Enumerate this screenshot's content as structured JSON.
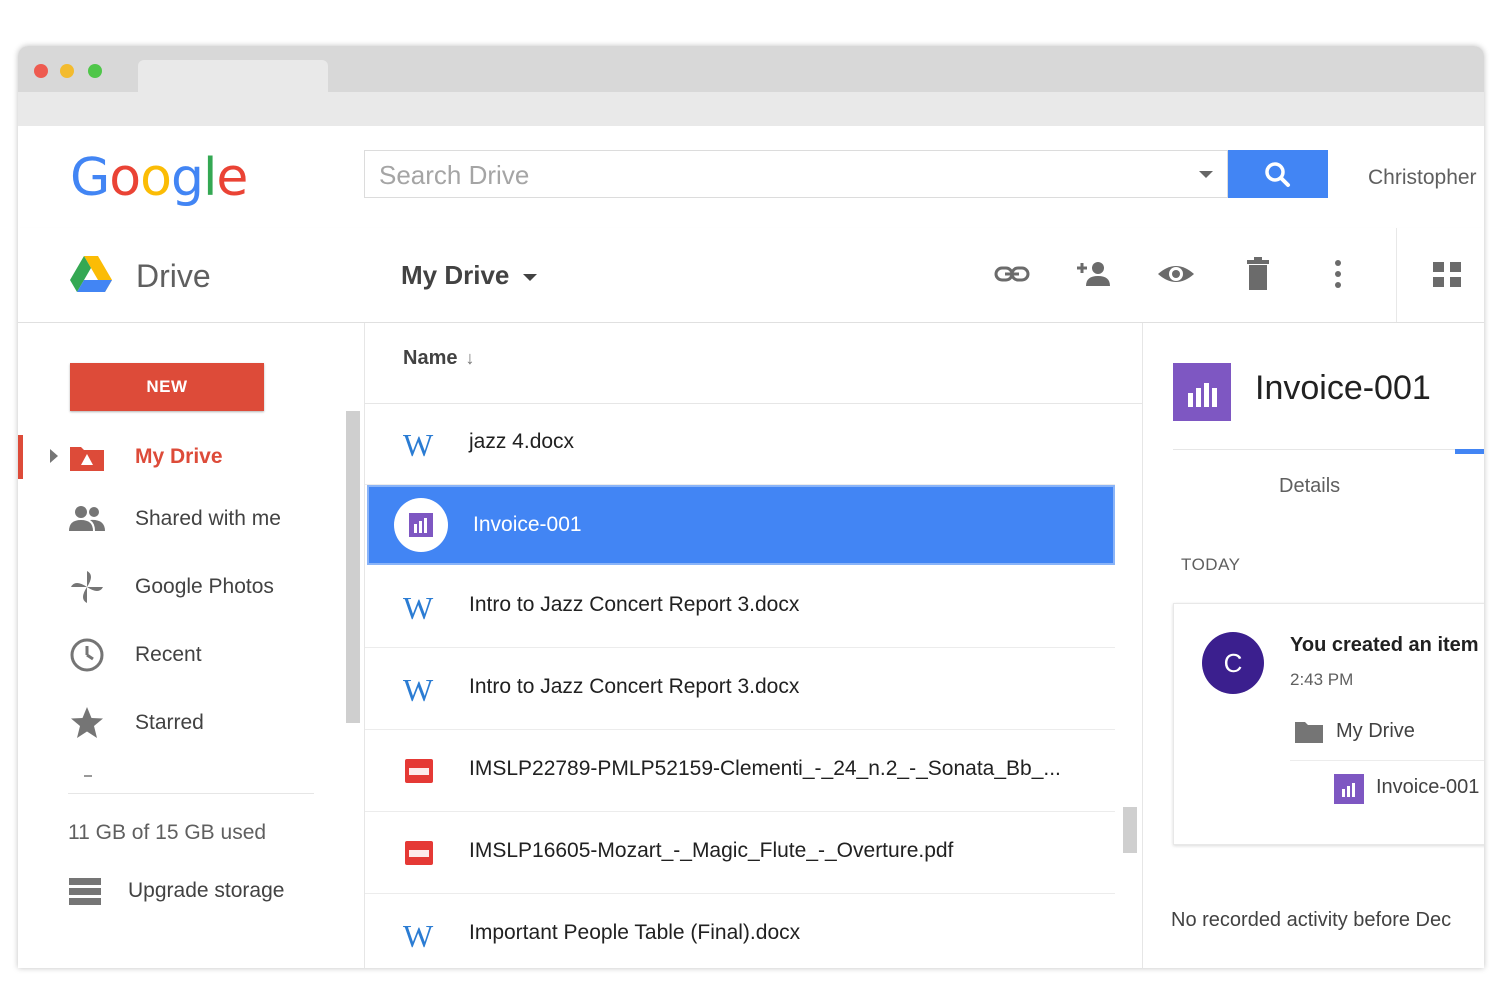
{
  "header": {
    "logo_text": "Google",
    "search_placeholder": "Search Drive",
    "user_name": "Christopher"
  },
  "toolbar": {
    "app_label": "Drive",
    "location_menu": "My Drive"
  },
  "sidebar": {
    "new_label": "NEW",
    "items": [
      {
        "label": "My Drive",
        "icon": "my-drive-icon",
        "active": true
      },
      {
        "label": "Shared with me",
        "icon": "shared-people-icon"
      },
      {
        "label": "Google Photos",
        "icon": "photos-pinwheel-icon"
      },
      {
        "label": "Recent",
        "icon": "clock-icon"
      },
      {
        "label": "Starred",
        "icon": "star-icon"
      }
    ],
    "storage_text": "11 GB of 15 GB used",
    "upgrade_label": "Upgrade storage"
  },
  "file_list": {
    "column_name": "Name",
    "sort_arrow": "↓",
    "rows": [
      {
        "name": "jazz 4.docx",
        "type": "word"
      },
      {
        "name": "Invoice-001",
        "type": "sheet",
        "selected": true
      },
      {
        "name": "Intro to Jazz Concert Report 3.docx",
        "type": "word"
      },
      {
        "name": "Intro to Jazz Concert Report 3.docx",
        "type": "word"
      },
      {
        "name": "IMSLP22789-PMLP52159-Clementi_-_24_n.2_-_Sonata_Bb_...",
        "type": "pdf"
      },
      {
        "name": "IMSLP16605-Mozart_-_Magic_Flute_-_Overture.pdf",
        "type": "pdf"
      },
      {
        "name": "Important People Table (Final).docx",
        "type": "word"
      }
    ]
  },
  "details": {
    "title": "Invoice-001",
    "tab_label": "Details",
    "section_label": "TODAY",
    "activity": {
      "avatar_letter": "C",
      "text": "You created an item",
      "time": "2:43 PM",
      "folder": "My Drive",
      "file": "Invoice-001"
    },
    "footer_text": "No recorded activity before Dec"
  },
  "colors": {
    "google_blue": "#4285f4",
    "google_red": "#dd4b39",
    "sheet_purple": "#7e57c2",
    "avatar": "#3b1f8e"
  }
}
